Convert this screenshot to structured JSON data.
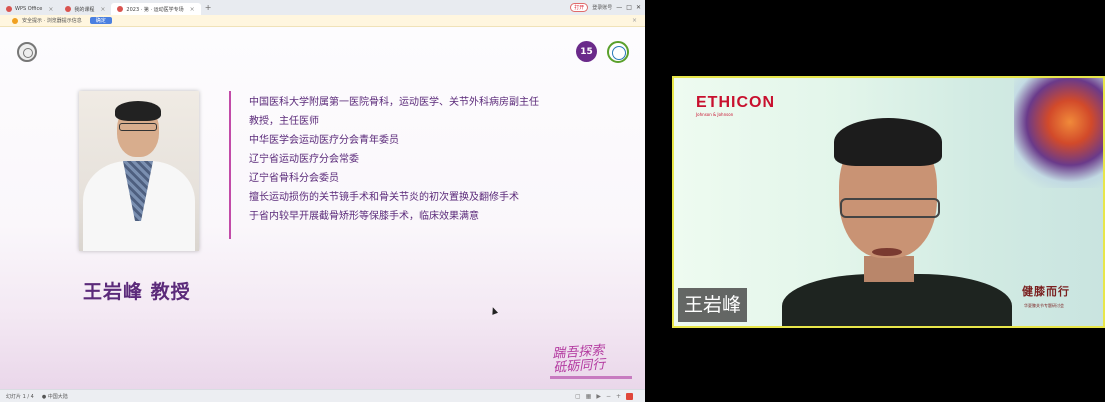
{
  "browser": {
    "tabs": [
      {
        "label": "WPS Office",
        "active": false
      },
      {
        "label": "我的课程",
        "active": false
      },
      {
        "label": "2023 · 第 · 运动医学专场",
        "active": true
      }
    ],
    "new_tab": "+",
    "right_pill": "打开",
    "right_login": "登录账号",
    "controls": [
      "—",
      "□",
      "✕"
    ]
  },
  "notification": {
    "text": "安全提示 · 浏览器提示信息",
    "button": "确定",
    "close": "×"
  },
  "slide": {
    "logo15_text": "15",
    "bio_lines": [
      "中国医科大学附属第一医院骨科，运动医学、关节外科病房副主任",
      "教授，主任医师",
      "中华医学会运动医疗分会青年委员",
      "辽宁省运动医疗分会常委",
      "辽宁省骨科分会委员",
      "擅长运动损伤的关节镜手术和骨关节炎的初次置换及翻修手术",
      "于省内较早开展截骨矫形等保膝手术，临床效果满意"
    ],
    "name_title": "王岩峰 教授",
    "calligraphy_line1": "踹吾探索",
    "calligraphy_line2": "砥砺同行"
  },
  "statusbar": {
    "page": "幻灯片 1 / 4",
    "status": "● 中国大陆"
  },
  "video": {
    "brand": "ETHICON",
    "brand_sub": "Johnson & Johnson",
    "slogan": "健膝而行",
    "slogan_sub": "华夏膝关节专题研讨会",
    "speaker_name": "王岩峰"
  },
  "colors": {
    "accent_purple": "#5b2a7a",
    "divider_magenta": "#c24ba8",
    "ethicon_red": "#c8102e",
    "video_border": "#e8e64a"
  }
}
